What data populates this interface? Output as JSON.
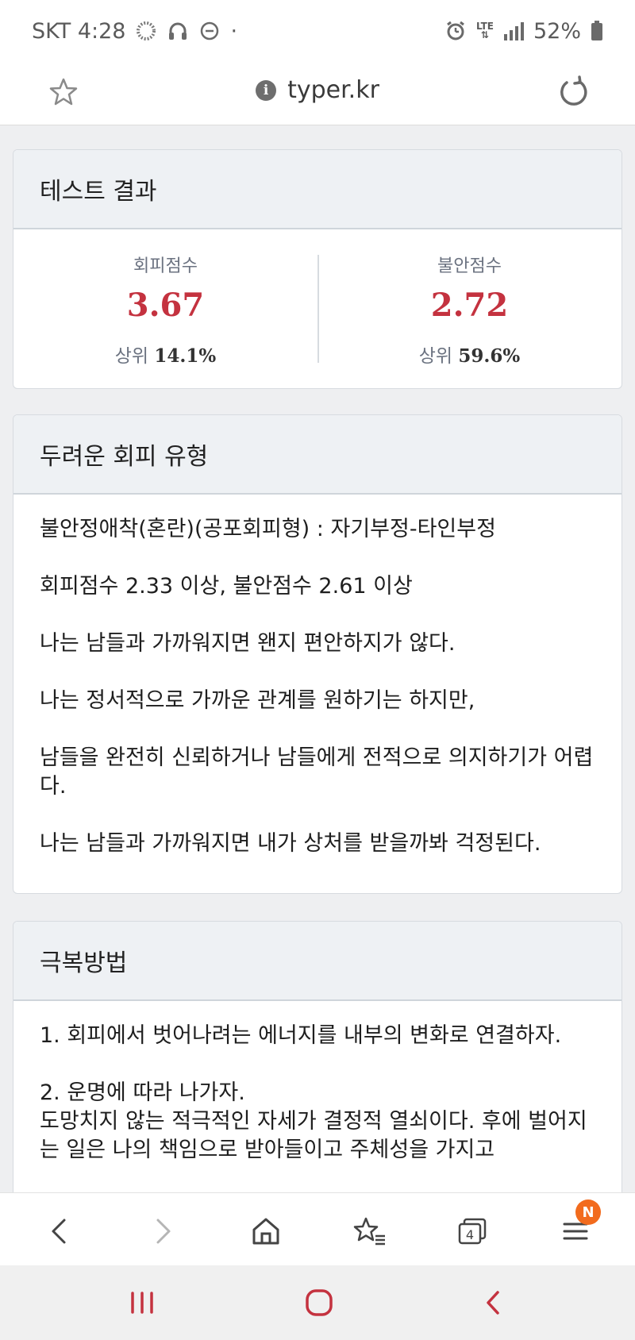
{
  "status_bar": {
    "carrier_time": "SKT 4:28",
    "dot": "·",
    "network": "LTE",
    "battery": "52%"
  },
  "url_bar": {
    "url": "typer.kr",
    "info_glyph": "i"
  },
  "result_card": {
    "title": "테스트 결과",
    "avoidance": {
      "label": "회피점수",
      "value": "3.67",
      "rank_prefix": "상위",
      "rank_value": "14.1%"
    },
    "anxiety": {
      "label": "불안점수",
      "value": "2.72",
      "rank_prefix": "상위",
      "rank_value": "59.6%"
    }
  },
  "type_card": {
    "title": "두려운 회피 유형",
    "lines": [
      "불안정애착(혼란)(공포회피형) : 자기부정-타인부정",
      "회피점수 2.33 이상, 불안점수 2.61 이상",
      "나는 남들과 가까워지면 왠지 편안하지가 않다.",
      "나는 정서적으로 가까운 관계를 원하기는 하지만,",
      "남들을 완전히 신뢰하거나 남들에게 전적으로 의지하기가 어렵다.",
      "나는 남들과 가까워지면 내가 상처를 받을까봐 걱정된다."
    ]
  },
  "overcome_card": {
    "title": "극복방법",
    "lines": [
      "1. 회피에서 벗어나려는 에너지를 내부의 변화로 연결하자.",
      "2. 운명에 따라 나가자.",
      "도망치지 않는 적극적인 자세가 결정적 열쇠이다. 후에 벌어지는 일은 나의 책임으로 받아들이고 주체성을 가지고"
    ]
  },
  "toolbar": {
    "tabs_count": "4",
    "menu_badge": "N"
  },
  "colors": {
    "score_red": "#c4323f",
    "badge_orange": "#f26b1d",
    "header_bg": "#eef1f4"
  }
}
